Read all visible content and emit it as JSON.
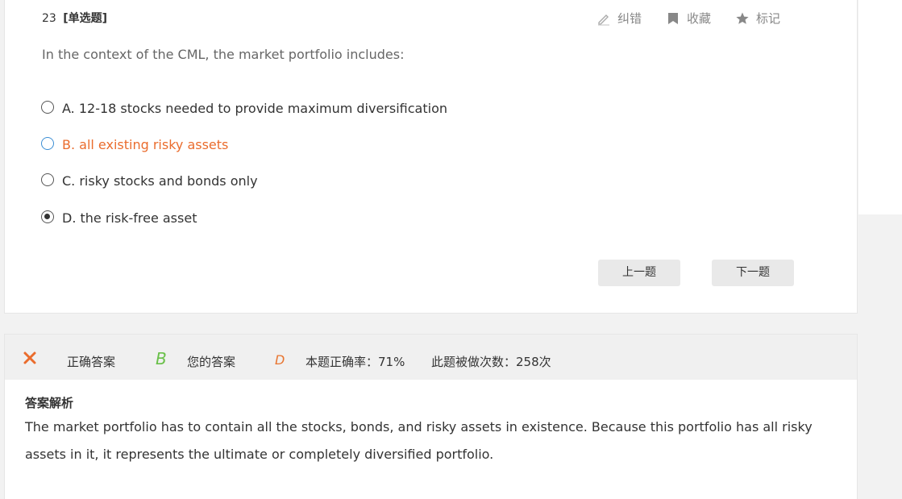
{
  "question": {
    "number": "23",
    "type": "[单选题]",
    "stem": "In the context of the CML, the market portfolio includes:",
    "options": [
      {
        "label": "A. 12-18 stocks needed to provide maximum diversification"
      },
      {
        "label": "B. all existing risky assets"
      },
      {
        "label": "C. risky stocks and bonds only"
      },
      {
        "label": "D. the risk-free asset"
      }
    ]
  },
  "toolbar": {
    "correct_error": "纠错",
    "favorite": "收藏",
    "mark": "标记"
  },
  "navigation": {
    "prev": "上一题",
    "next": "下一题"
  },
  "result": {
    "correct_answer_label": "正确答案",
    "correct_answer": "B",
    "your_answer_label": "您的答案",
    "your_answer": "D",
    "accuracy": "本题正确率：71%",
    "attempts": "此题被做次数：258次"
  },
  "explanation": {
    "title": "答案解析",
    "text": "The market portfolio has to contain all the stocks, bonds, and risky assets in existence. Because this portfolio has all risky assets in it, it represents the ultimate or completely diversified portfolio."
  },
  "colors": {
    "highlight_orange": "#ea6c2d",
    "correct_green": "#6ac04a",
    "wrong_orange": "#e8742f",
    "radio_blue": "#3c8ed4"
  },
  "icons": [
    "pencil-icon",
    "bookmark-icon",
    "star-icon",
    "close-icon"
  ]
}
